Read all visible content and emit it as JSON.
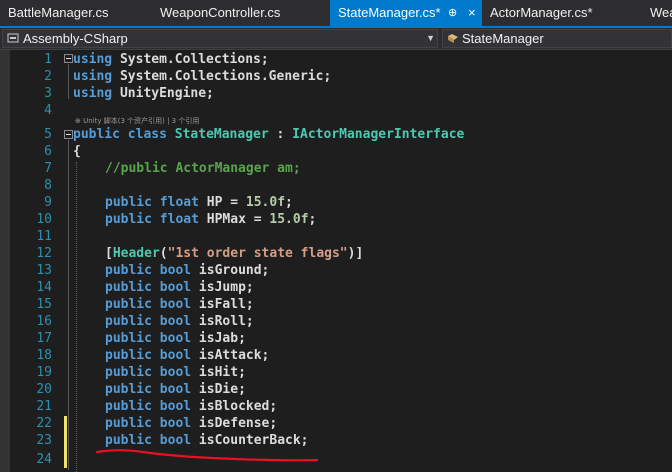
{
  "tabs": [
    {
      "label": "BattleManager.cs"
    },
    {
      "label": "WeaponController.cs"
    },
    {
      "label": "StateManager.cs*",
      "pin": "⊕",
      "close": "×"
    },
    {
      "label": "ActorManager.cs*"
    },
    {
      "label": "Wea"
    }
  ],
  "nav": {
    "project": "Assembly-CSharp",
    "class_name": "StateManager",
    "dropdown": "▼"
  },
  "code_lens": "⊕ Unity 脚本(3 个资产引用) | 3 个引用",
  "line_numbers": [
    "1",
    "2",
    "3",
    "4",
    "5",
    "6",
    "7",
    "8",
    "9",
    "10",
    "11",
    "12",
    "13",
    "14",
    "15",
    "16",
    "17",
    "18",
    "19",
    "20",
    "21",
    "22",
    "23",
    "24"
  ],
  "code": {
    "l1_kw": "using",
    "l1_ns": " System.Collections;",
    "l2_kw": "using",
    "l2_ns": " System.Collections.Generic;",
    "l3_kw": "using",
    "l3_ns": " UnityEngine;",
    "l5_kw1": "public",
    "l5_kw2": " class",
    "l5_class": " StateManager",
    "l5_colon": " : ",
    "l5_iface": "IActorManagerInterface",
    "l6_brace": "{",
    "l7_comment": "//public ActorManager am;",
    "l9_kw1": "public",
    "l9_kw2": " float",
    "l9_rest": " HP = ",
    "l9_num": "15.0f",
    "l9_end": ";",
    "l10_kw1": "public",
    "l10_kw2": " float",
    "l10_rest": " HPMax = ",
    "l10_num": "15.0f",
    "l10_end": ";",
    "l12_open": "[",
    "l12_attr": "Header",
    "l12_paren": "(",
    "l12_str": "\"1st order state flags\"",
    "l12_close": ")]",
    "bool_kw1": "public",
    "bool_kw2": " bool",
    "fields": [
      " isGround;",
      " isJump;",
      " isFall;",
      " isRoll;",
      " isJab;",
      " isAttack;",
      " isHit;",
      " isDie;",
      " isBlocked;",
      " isDefense;",
      " isCounterBack;"
    ]
  },
  "colors": {
    "keyword": "#569cd6",
    "type": "#4ec9b0",
    "comment": "#57a64a",
    "string": "#d69d85",
    "number": "#b5cea8",
    "line_number": "#2b91af",
    "active_tab": "#007acc",
    "annotation_red": "#e81123"
  }
}
